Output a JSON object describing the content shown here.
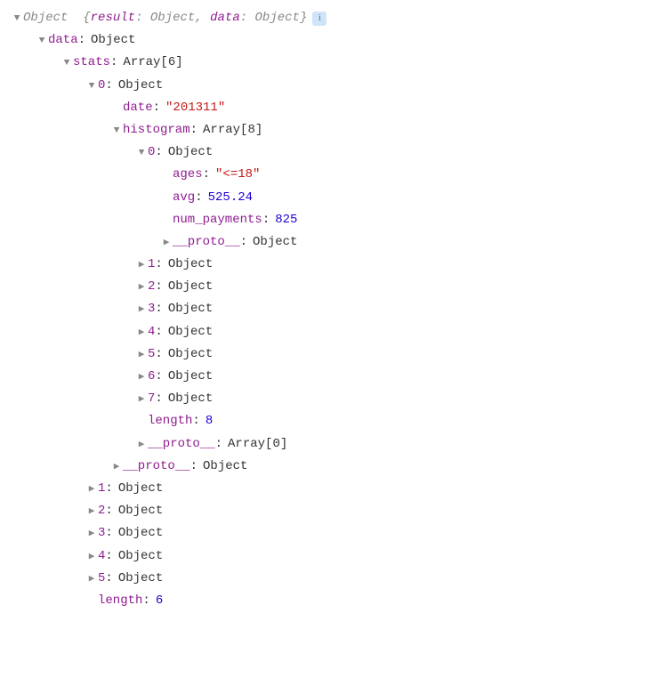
{
  "root": {
    "label": "Object",
    "summary_prefix": "{",
    "summary_key1": "result",
    "summary_val1": "Object",
    "summary_sep": ", ",
    "summary_key2": "data",
    "summary_val2": "Object",
    "summary_suffix": "}",
    "info": "i"
  },
  "data": {
    "key": "data",
    "val": "Object"
  },
  "stats": {
    "key": "stats",
    "val": "Array[6]",
    "length_key": "length",
    "length_val": "6",
    "item0": {
      "key": "0",
      "val": "Object",
      "date_key": "date",
      "date_val": "\"201311\"",
      "histogram": {
        "key": "histogram",
        "val": "Array[8]",
        "item0": {
          "key": "0",
          "val": "Object",
          "ages_key": "ages",
          "ages_val": "\"<=18\"",
          "avg_key": "avg",
          "avg_val": "525.24",
          "num_payments_key": "num_payments",
          "num_payments_val": "825",
          "proto_key": "__proto__",
          "proto_val": "Object"
        },
        "item1": {
          "key": "1",
          "val": "Object"
        },
        "item2": {
          "key": "2",
          "val": "Object"
        },
        "item3": {
          "key": "3",
          "val": "Object"
        },
        "item4": {
          "key": "4",
          "val": "Object"
        },
        "item5": {
          "key": "5",
          "val": "Object"
        },
        "item6": {
          "key": "6",
          "val": "Object"
        },
        "item7": {
          "key": "7",
          "val": "Object"
        },
        "length_key": "length",
        "length_val": "8",
        "proto_key": "__proto__",
        "proto_val": "Array[0]"
      },
      "proto_key": "__proto__",
      "proto_val": "Object"
    },
    "item1": {
      "key": "1",
      "val": "Object"
    },
    "item2": {
      "key": "2",
      "val": "Object"
    },
    "item3": {
      "key": "3",
      "val": "Object"
    },
    "item4": {
      "key": "4",
      "val": "Object"
    },
    "item5": {
      "key": "5",
      "val": "Object"
    }
  }
}
